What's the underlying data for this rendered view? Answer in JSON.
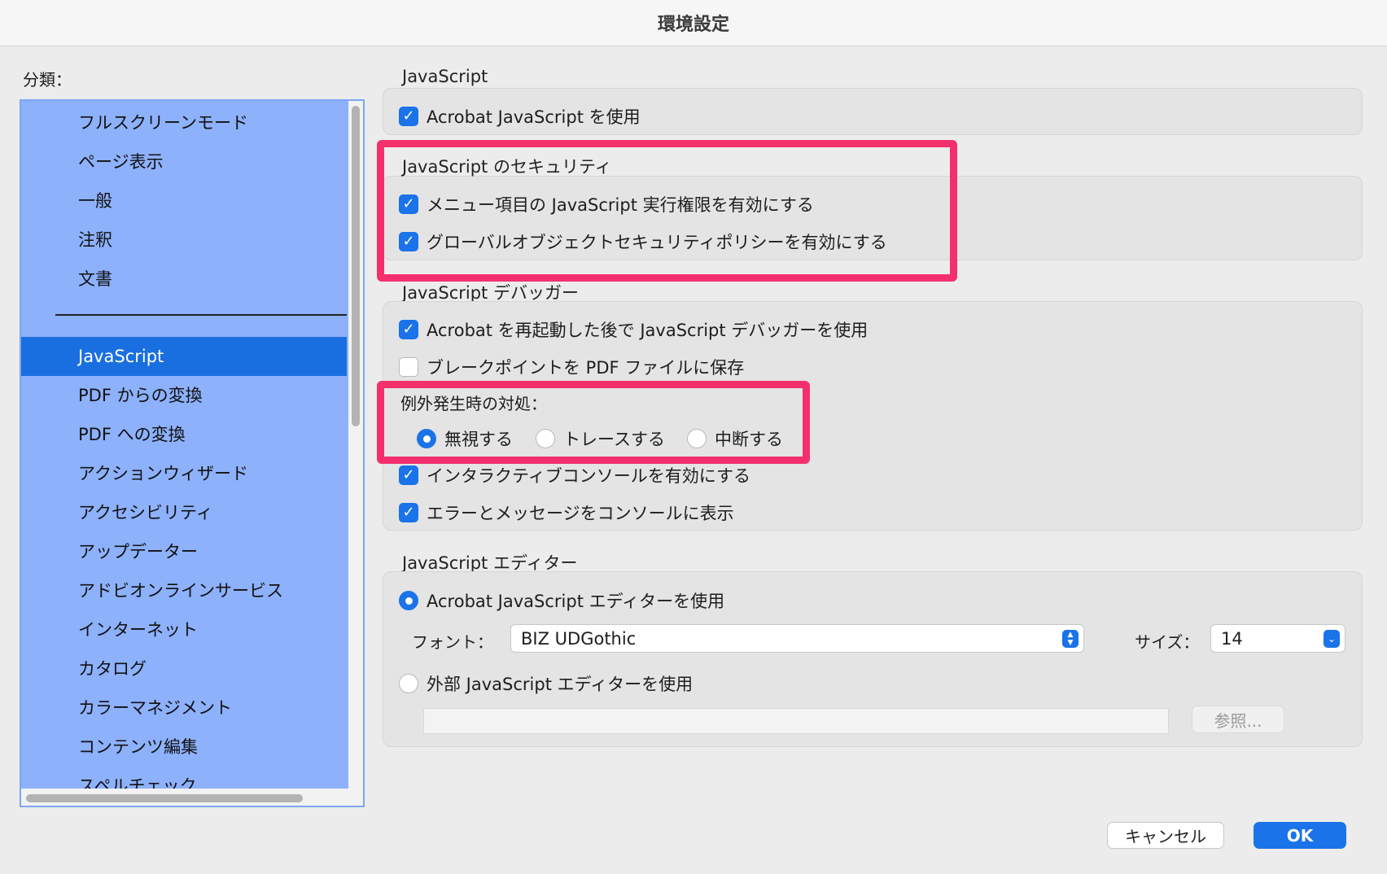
{
  "window": {
    "title": "環境設定"
  },
  "sidebar": {
    "label": "分類：",
    "items": [
      {
        "label": "フルスクリーンモード"
      },
      {
        "label": "ページ表示"
      },
      {
        "label": "一般"
      },
      {
        "label": "注釈"
      },
      {
        "label": "文書"
      },
      {
        "label": "JavaScript",
        "selected": true
      },
      {
        "label": "PDF からの変換"
      },
      {
        "label": "PDF への変換"
      },
      {
        "label": "アクションウィザード"
      },
      {
        "label": "アクセシビリティ"
      },
      {
        "label": "アップデーター"
      },
      {
        "label": "アドビオンラインサービス"
      },
      {
        "label": "インターネット"
      },
      {
        "label": "カタログ"
      },
      {
        "label": "カラーマネジメント"
      },
      {
        "label": "コンテンツ編集"
      },
      {
        "label": "スペルチェック"
      }
    ]
  },
  "js": {
    "title": "JavaScript",
    "enable": {
      "label": "Acrobat JavaScript を使用",
      "checked": true
    }
  },
  "security": {
    "title": "JavaScript のセキュリティ",
    "menu_privilege": {
      "label": "メニュー項目の JavaScript 実行権限を有効にする",
      "checked": true
    },
    "global_policy": {
      "label": "グローバルオブジェクトセキュリティポリシーを有効にする",
      "checked": true
    }
  },
  "debugger": {
    "title": "JavaScript デバッガー",
    "enable_after_restart": {
      "label": "Acrobat を再起動した後で JavaScript デバッガーを使用",
      "checked": true
    },
    "save_breakpoints": {
      "label": "ブレークポイントを PDF ファイルに保存",
      "checked": false
    },
    "exception_label": "例外発生時の対処：",
    "exception_options": [
      {
        "label": "無視する",
        "selected": true
      },
      {
        "label": "トレースする",
        "selected": false
      },
      {
        "label": "中断する",
        "selected": false
      }
    ],
    "interactive_console": {
      "label": "インタラクティブコンソールを有効にする",
      "checked": true
    },
    "show_errors": {
      "label": "エラーとメッセージをコンソールに表示",
      "checked": true
    }
  },
  "editor": {
    "title": "JavaScript エディター",
    "use_acrobat": {
      "label": "Acrobat JavaScript エディターを使用",
      "selected": true
    },
    "font_label": "フォント：",
    "font_value": "BIZ UDGothic",
    "size_label": "サイズ：",
    "size_value": "14",
    "use_external": {
      "label": "外部 JavaScript エディターを使用",
      "selected": false
    },
    "browse_label": "参照..."
  },
  "buttons": {
    "cancel": "キャンセル",
    "ok": "OK"
  },
  "colors": {
    "accent": "#1a73e8",
    "sidebar_bg": "#8db1fb",
    "highlight": "#f3306d"
  }
}
